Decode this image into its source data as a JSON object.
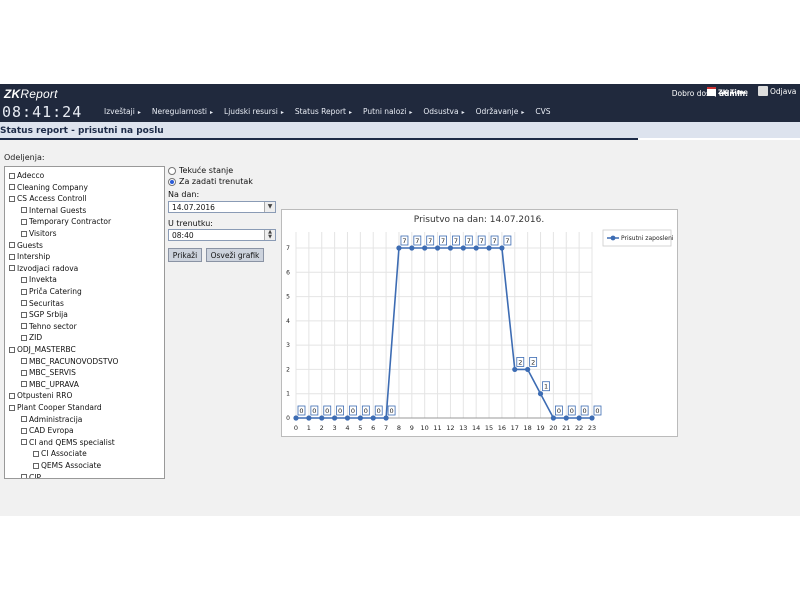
{
  "app": {
    "logo": {
      "part1": "ZK",
      "part2": "Report"
    },
    "clock": "08:41:24",
    "welcome": {
      "prefix": "Dobro došli,",
      "user": "admin."
    },
    "zk_time_label": "ZK Time",
    "logout_label": "Odjava"
  },
  "nav": {
    "items": [
      {
        "label": "Izveštaji",
        "arrow": "▸"
      },
      {
        "label": "Neregularnosti",
        "arrow": "▸"
      },
      {
        "label": "Ljudski resursi",
        "arrow": "▸"
      },
      {
        "label": "Status Report",
        "arrow": "▸"
      },
      {
        "label": "Putni nalozi",
        "arrow": "▸"
      },
      {
        "label": "Odsustva",
        "arrow": "▸"
      },
      {
        "label": "Održavanje",
        "arrow": "▸"
      },
      {
        "label": "CVS",
        "arrow": ""
      }
    ]
  },
  "page": {
    "title": "Status report - prisutni na poslu",
    "dept_label": "Odeljenja:"
  },
  "tree": {
    "items": [
      {
        "label": "Adecco",
        "level": 0
      },
      {
        "label": "Cleaning Company",
        "level": 0
      },
      {
        "label": "CS Access Controll",
        "level": 0
      },
      {
        "label": "Internal Guests",
        "level": 1
      },
      {
        "label": "Temporary Contractor",
        "level": 1
      },
      {
        "label": "Visitors",
        "level": 1
      },
      {
        "label": "Guests",
        "level": 0
      },
      {
        "label": "Intership",
        "level": 0
      },
      {
        "label": "Izvodjaci radova",
        "level": 0
      },
      {
        "label": "Invekta",
        "level": 1
      },
      {
        "label": "Priča Catering",
        "level": 1
      },
      {
        "label": "Securitas",
        "level": 1
      },
      {
        "label": "SGP Srbija",
        "level": 1
      },
      {
        "label": "Tehno sector",
        "level": 1
      },
      {
        "label": "ZID",
        "level": 1
      },
      {
        "label": "ODJ_MASTERBC",
        "level": 0
      },
      {
        "label": "MBC_RACUNOVODSTVO",
        "level": 1
      },
      {
        "label": "MBC_SERVIS",
        "level": 1
      },
      {
        "label": "MBC_UPRAVA",
        "level": 1
      },
      {
        "label": "Otpusteni RRO",
        "level": 0
      },
      {
        "label": "Plant Cooper Standard",
        "level": 0
      },
      {
        "label": "Administracija",
        "level": 1
      },
      {
        "label": "CAD Evropa",
        "level": 1
      },
      {
        "label": "CI and QEMS specialist",
        "level": 1
      },
      {
        "label": "CI Associate",
        "level": 2
      },
      {
        "label": "QEMS Associate",
        "level": 2
      },
      {
        "label": "CIP",
        "level": 1
      }
    ]
  },
  "options": {
    "radio_current": "Tekuće stanje",
    "radio_given": "Za zadati trenutak",
    "selected": "given",
    "date_label": "Na dan:",
    "date_value": "14.07.2016",
    "time_label": "U trenutku:",
    "time_value": "08:40",
    "show_button": "Prikaži",
    "refresh_button": "Osveži grafik"
  },
  "chart_data": {
    "type": "line",
    "title": "Prisutvo na dan: 14.07.2016.",
    "xlabel": "",
    "ylabel": "",
    "x": [
      0,
      1,
      2,
      3,
      4,
      5,
      6,
      7,
      8,
      9,
      10,
      11,
      12,
      13,
      14,
      15,
      16,
      17,
      18,
      19,
      20,
      21,
      22,
      23
    ],
    "series": [
      {
        "name": "Prisutni zaposleni",
        "color": "#3d6cb3",
        "values": [
          0,
          0,
          0,
          0,
          0,
          0,
          0,
          0,
          7,
          7,
          7,
          7,
          7,
          7,
          7,
          7,
          7,
          2,
          2,
          1,
          0,
          0,
          0,
          0
        ]
      }
    ],
    "xlim": [
      0,
      23
    ],
    "ylim": [
      0,
      7
    ],
    "yticks": [
      0,
      1,
      2,
      3,
      4,
      5,
      6,
      7
    ],
    "grid": true,
    "legend": "top-right",
    "data_labels": true
  }
}
